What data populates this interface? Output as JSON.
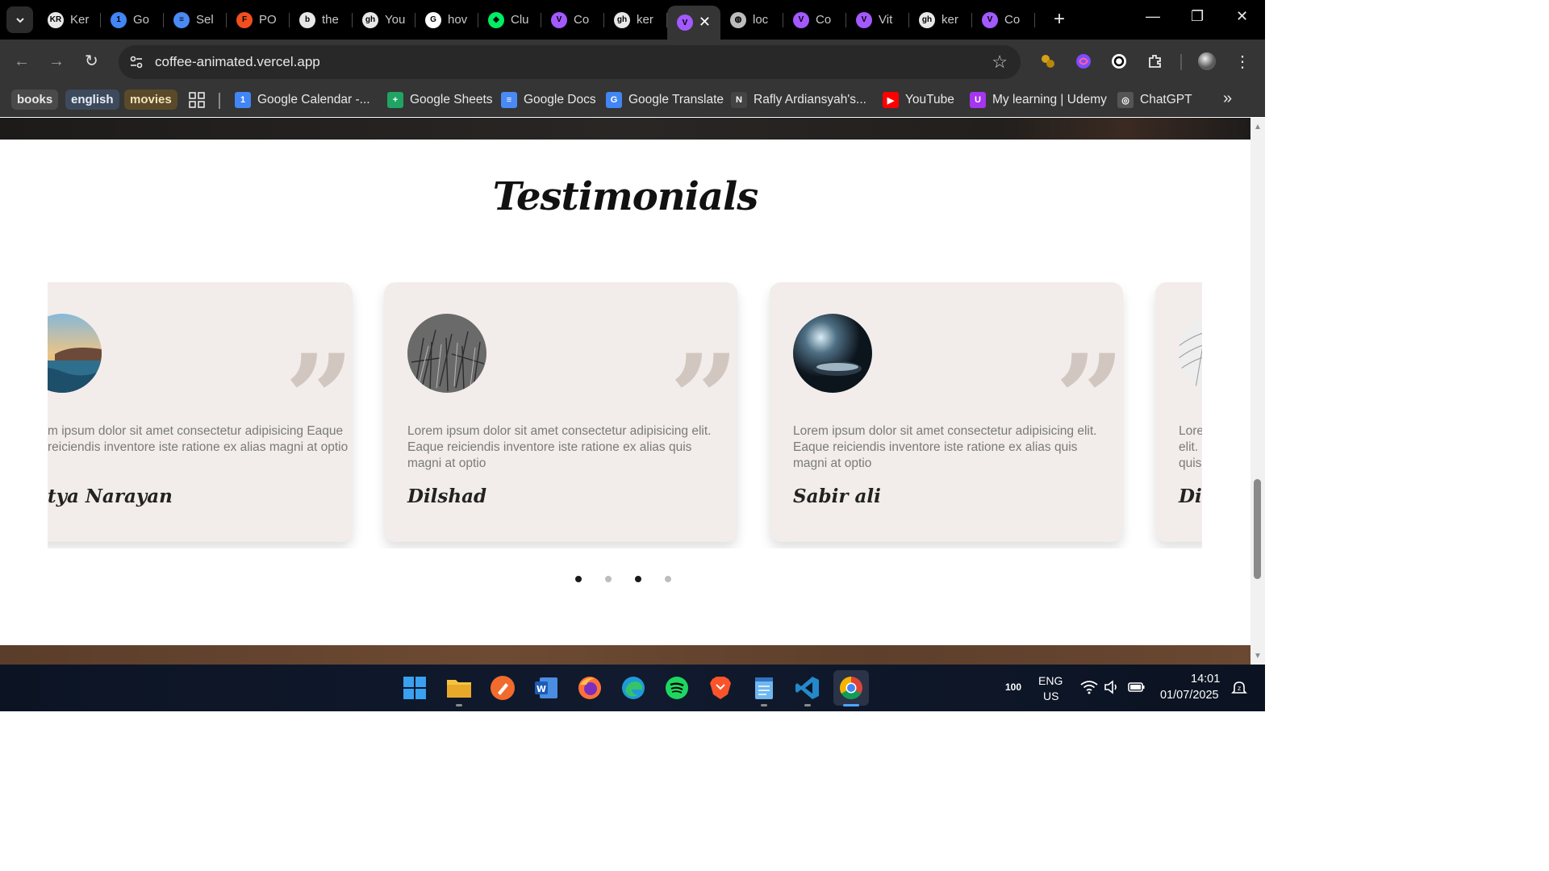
{
  "browser": {
    "tabs": [
      {
        "label": "Ker",
        "favicon": "KR",
        "color": "#e8e8e8"
      },
      {
        "label": "Go",
        "favicon": "1",
        "color": "#4285f4"
      },
      {
        "label": "Sel",
        "favicon": "≡",
        "color": "#4a8af4"
      },
      {
        "label": "PO",
        "favicon": "F",
        "color": "#f24e1e"
      },
      {
        "label": "the",
        "favicon": "b",
        "color": "#e8e8e8"
      },
      {
        "label": "You",
        "favicon": "gh",
        "color": "#e8e8e8"
      },
      {
        "label": "hov",
        "favicon": "G",
        "color": "#ffffff"
      },
      {
        "label": "Clu",
        "favicon": "◆",
        "color": "#00ed64"
      },
      {
        "label": "Co",
        "favicon": "V",
        "color": "#a259ff"
      },
      {
        "label": "ker",
        "favicon": "gh",
        "color": "#e8e8e8"
      },
      {
        "label": "",
        "favicon": "V",
        "color": "#a259ff",
        "active": true
      },
      {
        "label": "loc",
        "favicon": "◍",
        "color": "#bdbdbd"
      },
      {
        "label": "Co",
        "favicon": "V",
        "color": "#a259ff"
      },
      {
        "label": "Vit",
        "favicon": "V",
        "color": "#a259ff"
      },
      {
        "label": "ker",
        "favicon": "gh",
        "color": "#e8e8e8"
      },
      {
        "label": "Co",
        "favicon": "V",
        "color": "#a259ff"
      }
    ],
    "url": "coffee-animated.vercel.app",
    "bookmarks": {
      "chips": [
        {
          "label": "books",
          "bg": "#4a4a4a",
          "fg": "#e8e8e8"
        },
        {
          "label": "english",
          "bg": "#3d4a5c",
          "fg": "#e8eef8"
        },
        {
          "label": "movies",
          "bg": "#5a4a2a",
          "fg": "#f2e3b8"
        }
      ],
      "items": [
        {
          "label": "Google Calendar -...",
          "icon": "1",
          "color": "#4285f4"
        },
        {
          "label": "Google Sheets",
          "icon": "+",
          "color": "#1fa463"
        },
        {
          "label": "Google Docs",
          "icon": "≡",
          "color": "#4a8af4"
        },
        {
          "label": "Google Translate",
          "icon": "G",
          "color": "#4285f4"
        },
        {
          "label": "Rafly Ardiansyah's...",
          "icon": "N",
          "color": "#444444"
        },
        {
          "label": "YouTube",
          "icon": "▶",
          "color": "#ff0000"
        },
        {
          "label": "My learning | Udemy",
          "icon": "U",
          "color": "#a435f0"
        },
        {
          "label": "ChatGPT",
          "icon": "◎",
          "color": "#555555"
        }
      ],
      "more": "»"
    }
  },
  "page": {
    "section_title": "Testimonials",
    "testimonials": [
      {
        "name": "tya Narayan",
        "text": "m ipsum dolor sit amet consectetur adipisicing Eaque reiciendis inventore iste ratione ex alias  magni at optio",
        "avatar": "seascape"
      },
      {
        "name": "Dilshad",
        "text": "Lorem ipsum dolor sit amet consectetur adipisicing elit. Eaque reiciendis inventore iste ratione ex alias quis magni at optio",
        "avatar": "grass"
      },
      {
        "name": "Sabir ali",
        "text": "Lorem ipsum dolor sit amet consectetur adipisicing elit. Eaque reiciendis inventore iste ratione ex alias quis magni at optio",
        "avatar": "phone"
      },
      {
        "name": "Dip",
        "text": "Lore elit. quis",
        "avatar": "architecture"
      }
    ],
    "quote_glyph": "”",
    "carousel_dots": 4,
    "active_dot": 3
  },
  "taskbar": {
    "apps": [
      "start",
      "file-explorer",
      "draw",
      "word",
      "firefox",
      "edge",
      "spotify",
      "brave",
      "notepad",
      "vscode",
      "chrome"
    ],
    "battery_label": "100",
    "language": "ENG",
    "region": "US",
    "time": "14:01",
    "date": "01/07/2025"
  }
}
